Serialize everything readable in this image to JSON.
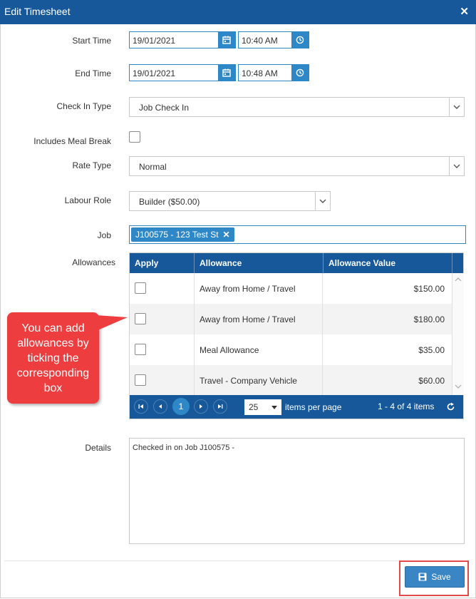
{
  "window": {
    "title": "Edit Timesheet"
  },
  "form": {
    "start_time": {
      "label": "Start Time",
      "date": "19/01/2021",
      "time": "10:40 AM"
    },
    "end_time": {
      "label": "End Time",
      "date": "19/01/2021",
      "time": "10:48 AM"
    },
    "check_in_type": {
      "label": "Check In Type",
      "value": "Job Check In"
    },
    "meal_break": {
      "label": "Includes Meal Break",
      "checked": false
    },
    "rate_type": {
      "label": "Rate Type",
      "value": "Normal"
    },
    "labour_role": {
      "label": "Labour Role",
      "value": "Builder ($50.00)"
    },
    "job": {
      "label": "Job",
      "tag": "J100575 - 123 Test St"
    },
    "allowances": {
      "label": "Allowances",
      "columns": [
        "Apply",
        "Allowance",
        "Allowance Value"
      ],
      "rows": [
        {
          "name": "Away from Home / Travel",
          "value": "$150.00"
        },
        {
          "name": "Away from Home / Travel",
          "value": "$180.00"
        },
        {
          "name": "Meal Allowance",
          "value": "$35.00"
        },
        {
          "name": "Travel - Company Vehicle",
          "value": "$60.00"
        }
      ],
      "pager": {
        "current_page": "1",
        "page_size": "25",
        "page_size_label": "items per page",
        "summary": "1 - 4 of 4 items"
      }
    },
    "details": {
      "label": "Details",
      "value": "Checked in on Job J100575 -"
    }
  },
  "callout": {
    "text": "You can add allowances by ticking the corresponding box"
  },
  "footer": {
    "save_label": "Save"
  },
  "colors": {
    "header_blue": "#16589a",
    "accent_blue": "#2e88c8",
    "callout_red": "#ee3d3f",
    "highlight_red": "#e24a4a"
  }
}
